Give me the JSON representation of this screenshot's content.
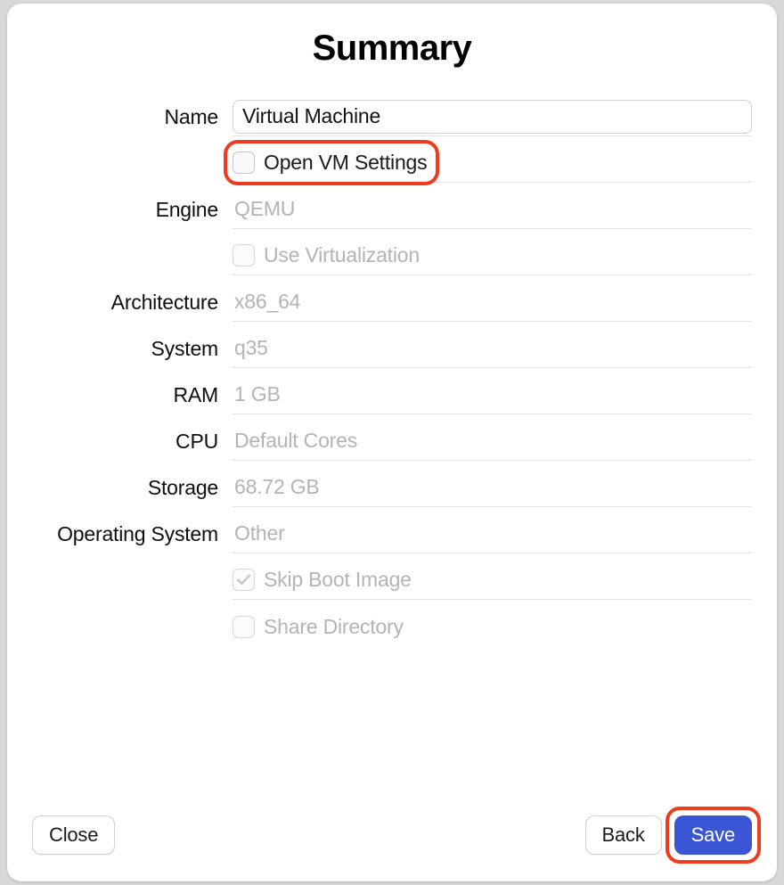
{
  "title": "Summary",
  "labels": {
    "name": "Name",
    "engine": "Engine",
    "architecture": "Architecture",
    "system": "System",
    "ram": "RAM",
    "cpu": "CPU",
    "storage": "Storage",
    "os": "Operating System"
  },
  "values": {
    "name": "Virtual Machine",
    "engine": "QEMU",
    "architecture": "x86_64",
    "system": "q35",
    "ram": "1 GB",
    "cpu": "Default Cores",
    "storage": "68.72 GB",
    "os": "Other"
  },
  "checkboxes": {
    "open_settings": "Open VM Settings",
    "use_virtualization": "Use Virtualization",
    "skip_boot_image": "Skip Boot Image",
    "share_directory": "Share Directory"
  },
  "buttons": {
    "close": "Close",
    "back": "Back",
    "save": "Save"
  }
}
